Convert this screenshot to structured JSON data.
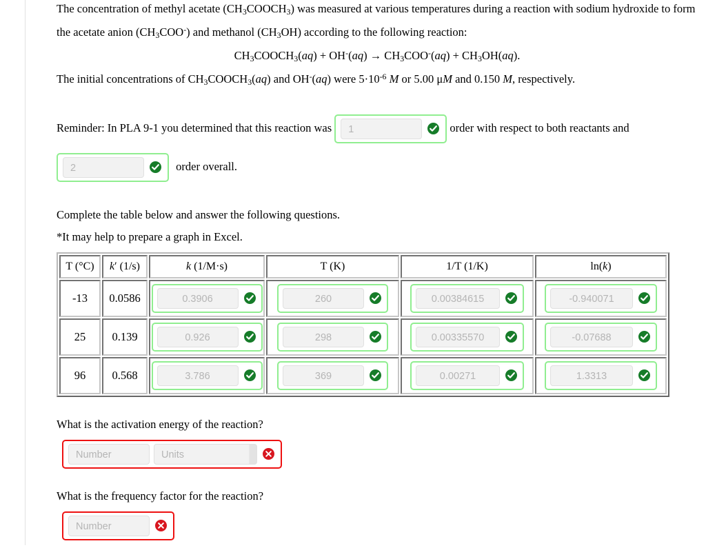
{
  "intro": {
    "line1_a": "The concentration of methyl acetate (CH",
    "line1_b": "COOCH",
    "line1_c": ") was measured at various temperatures during a reaction with sodium hydroxide to form the acetate anion (CH",
    "line1_d": "COO",
    "line1_e": ") and methanol (CH",
    "line1_f": "OH) according to the following reaction:",
    "equation": "CH3COOCH3(aq) + OH-(aq) → CH3COO-(aq) + CH3OH(aq).",
    "line3": "The initial concentrations of CH3COOCH3(aq) and OH-(aq) were 5·10-6 M or 5.00 μM and 0.150 M, respectively."
  },
  "reminder": {
    "prefix": "Reminder: In PLA 9-1 you determined that this reaction was",
    "field1_value": "1",
    "middle": "order with respect to both reactants and",
    "field2_value": "2",
    "suffix": "order overall.",
    "status_icon": "check-circle-icon"
  },
  "instructions": {
    "line1": "Complete the table below and answer the following questions.",
    "line2": "*It may help to prepare a graph in Excel."
  },
  "table": {
    "headers": {
      "t_celsius": "T (°C)",
      "k_prime": "k′ (1/s)",
      "k": "k (1/M·s)",
      "t_kelvin": "T (K)",
      "inv_t": "1/T (1/K)",
      "ln_k": "ln(k)"
    },
    "rows": [
      {
        "t_celsius": "-13",
        "k_prime": "0.0586",
        "k": "0.3906",
        "t_kelvin": "260",
        "inv_t": "0.00384615",
        "ln_k": "-0.940071",
        "status": "correct"
      },
      {
        "t_celsius": "25",
        "k_prime": "0.139",
        "k": "0.926",
        "t_kelvin": "298",
        "inv_t": "0.00335570",
        "ln_k": "-0.07688",
        "status": "correct"
      },
      {
        "t_celsius": "96",
        "k_prime": "0.568",
        "k": "3.786",
        "t_kelvin": "369",
        "inv_t": "0.00271",
        "ln_k": "1.3313",
        "status": "correct"
      }
    ]
  },
  "questions": [
    {
      "text": "What is the activation energy of the reaction?",
      "number_placeholder": "Number",
      "units_placeholder": "Units",
      "has_units": true,
      "status": "incorrect",
      "status_icon": "x-circle-icon"
    },
    {
      "text": "What is the frequency factor for the reaction?",
      "number_placeholder": "Number",
      "has_units": false,
      "status": "incorrect",
      "status_icon": "x-circle-icon"
    }
  ],
  "colors": {
    "correct_border": "#90ee90",
    "correct_icon": "#167c29",
    "incorrect_border": "#ee1111",
    "incorrect_icon": "#d8161f",
    "field_bg": "#f2f2f2",
    "placeholder_text": "#b5b5b5"
  }
}
